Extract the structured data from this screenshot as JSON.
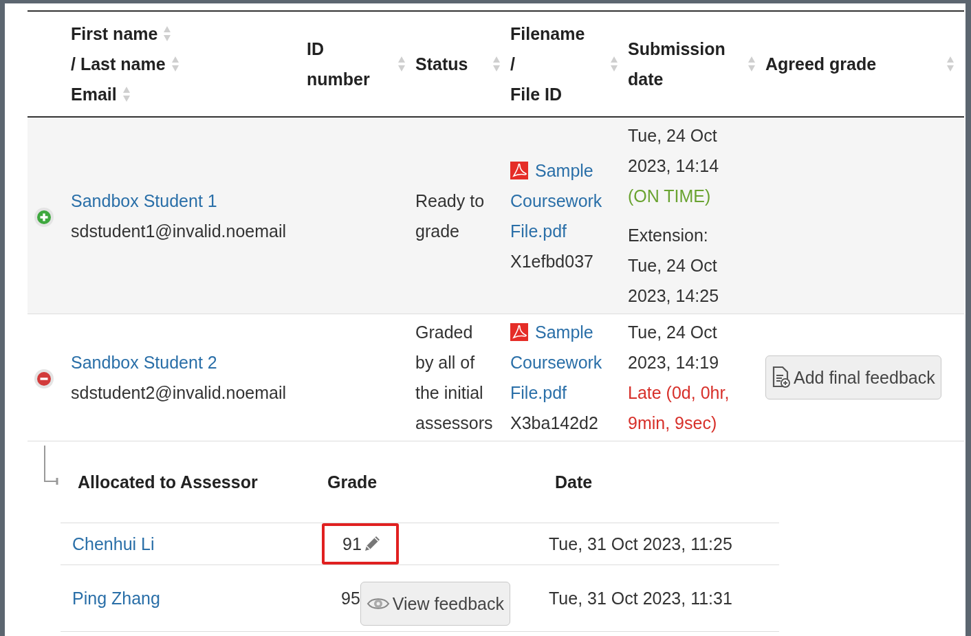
{
  "table": {
    "name_header": [
      {
        "label": "First name"
      },
      {
        "label": "/ Last name"
      },
      {
        "label": "Email"
      }
    ],
    "columns": [
      {
        "lines": [
          "ID",
          "number"
        ]
      },
      {
        "lines": [
          "Status"
        ]
      },
      {
        "lines": [
          "Filename",
          "/",
          "File ID"
        ]
      },
      {
        "lines": [
          "Submission",
          "date"
        ]
      },
      {
        "lines": [
          "Agreed grade"
        ]
      }
    ],
    "rows": [
      {
        "expanded": false,
        "name": "Sandbox Student 1",
        "email": "sdstudent1@invalid.noemail",
        "status": "Ready to grade",
        "file": {
          "name": "Sample Coursework File.pdf",
          "id": "X1efbd037"
        },
        "submission": [
          {
            "kind": "date",
            "text": "Tue, 24 Oct 2023, 14:14"
          },
          {
            "kind": "on_time",
            "text": "(ON TIME)"
          },
          {
            "kind": "extension",
            "text": "Extension: Tue, 24 Oct 2023, 14:25"
          }
        ]
      },
      {
        "expanded": true,
        "name": "Sandbox Student 2",
        "email": "sdstudent2@invalid.noemail",
        "status": "Graded by all of the initial assessors",
        "file": {
          "name": "Sample Coursework File.pdf",
          "id": "X3ba142d2"
        },
        "submission": [
          {
            "kind": "date",
            "text": "Tue, 24 Oct 2023, 14:19"
          },
          {
            "kind": "late",
            "text": "Late (0d, 0hr, 9min, 9sec)"
          }
        ],
        "agreed_button": "Add final feedback",
        "assessors": {
          "columns": [
            "Allocated to Assessor",
            "Grade",
            "Date"
          ],
          "rows": [
            {
              "name": "Chenhui Li",
              "grade": "91",
              "kind": "edit",
              "highlighted": true,
              "date": "Tue, 31 Oct 2023, 11:25"
            },
            {
              "name": "Ping Zhang",
              "grade": "95",
              "kind": "view",
              "button": "View feedback",
              "highlighted": false,
              "date": "Tue, 31 Oct 2023, 11:31"
            }
          ]
        }
      }
    ]
  }
}
